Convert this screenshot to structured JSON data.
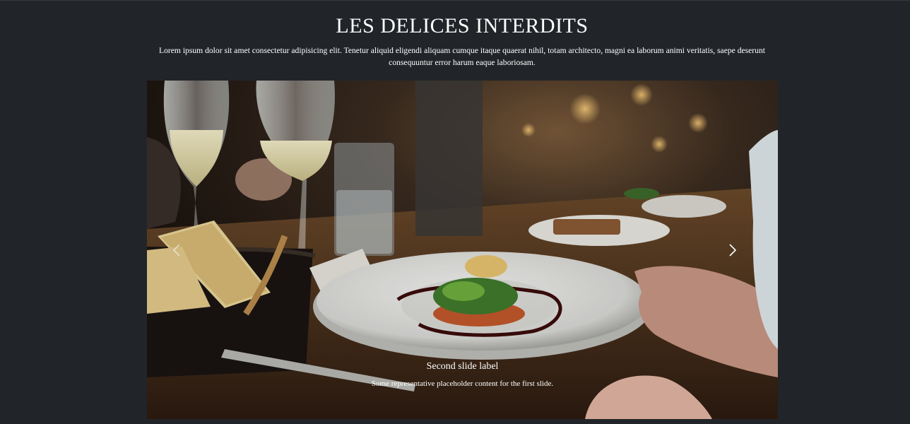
{
  "header": {
    "title": "LES DELICES INTERDITS",
    "intro": "Lorem ipsum dolor sit amet consectetur adipisicing elit. Tenetur aliquid eligendi aliquam cumque itaque quaerat nihil, totam architecto, magni ea laborum animi veritatis, saepe deserunt consequuntur error harum eaque laboriosam."
  },
  "carousel": {
    "image_alt": "Restaurant table with plated dish, wine glasses and bread basket",
    "caption_title": "Second slide label",
    "caption_text": "Some representative placeholder content for the first slide.",
    "prev_icon": "chevron-left-icon",
    "next_icon": "chevron-right-icon"
  },
  "colors": {
    "background": "#212529",
    "text": "#ffffff"
  }
}
